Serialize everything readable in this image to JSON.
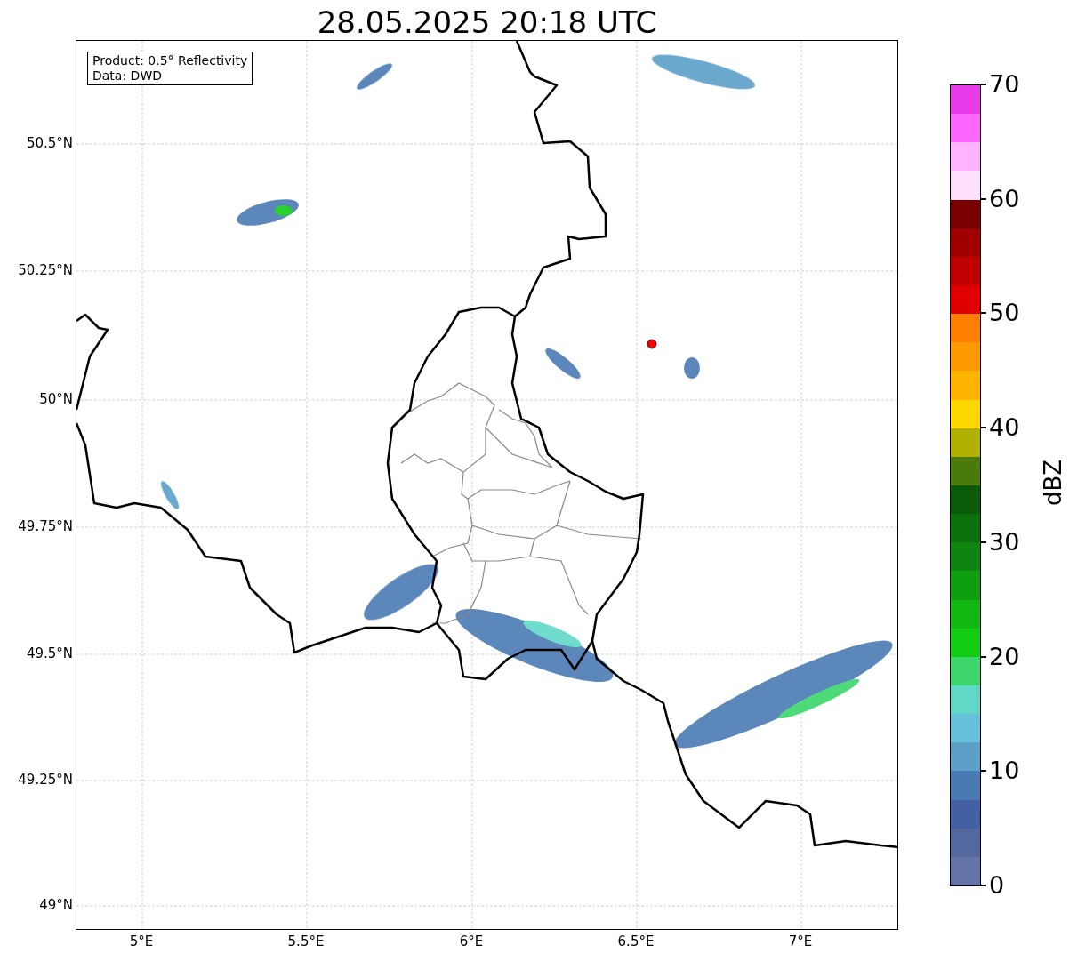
{
  "title": "28.05.2025 20:18 UTC",
  "info_box": {
    "lines": [
      "Product: 0.5° Reflectivity",
      "Data: DWD"
    ]
  },
  "map": {
    "lat_labels": [
      "50.5°N",
      "50.25°N",
      "50°N",
      "49.75°N",
      "49.5°N",
      "49.25°N",
      "49°N"
    ],
    "lon_labels": [
      "5°E",
      "5.5°E",
      "6°E",
      "6.5°E",
      "7°E"
    ]
  },
  "colorbar": {
    "label": "dBZ",
    "ticks": [
      "70",
      "60",
      "50",
      "40",
      "30",
      "20",
      "10",
      "0"
    ],
    "segments": [
      {
        "color": "#e83ae8"
      },
      {
        "color": "#ff66ff"
      },
      {
        "color": "#ffb3ff"
      },
      {
        "color": "#ffe0ff"
      },
      {
        "color": "#780000"
      },
      {
        "color": "#a00000"
      },
      {
        "color": "#c00000"
      },
      {
        "color": "#e00000"
      },
      {
        "color": "#ff7f00"
      },
      {
        "color": "#ff9900"
      },
      {
        "color": "#ffb400"
      },
      {
        "color": "#ffd700"
      },
      {
        "color": "#b0b000"
      },
      {
        "color": "#4a7a0a"
      },
      {
        "color": "#0a5a0a"
      },
      {
        "color": "#0a700a"
      },
      {
        "color": "#0e850e"
      },
      {
        "color": "#0f9e0f"
      },
      {
        "color": "#10b810"
      },
      {
        "color": "#12cc12"
      },
      {
        "color": "#3cd66a"
      },
      {
        "color": "#60d8c8"
      },
      {
        "color": "#66c2dc"
      },
      {
        "color": "#5b9fc8"
      },
      {
        "color": "#4a7ab4"
      },
      {
        "color": "#4460a4"
      },
      {
        "color": "#5468a0"
      },
      {
        "color": "#6474a8"
      }
    ]
  }
}
